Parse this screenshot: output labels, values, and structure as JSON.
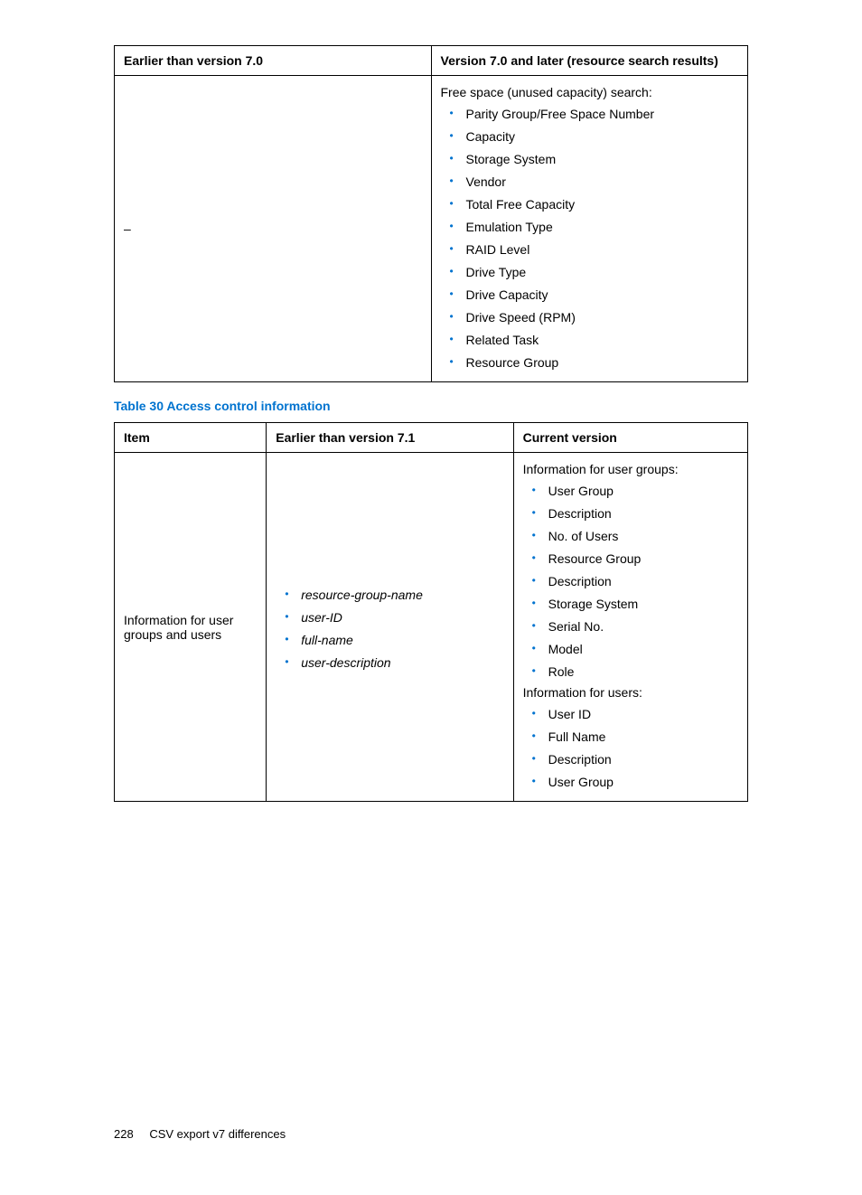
{
  "table1": {
    "headers": {
      "col1": "Earlier than version 7.0",
      "col2": "Version 7.0 and later (resource search results)"
    },
    "row": {
      "left": "–",
      "right": {
        "intro": "Free space (unused capacity) search:",
        "items": [
          "Parity Group/Free Space Number",
          "Capacity",
          "Storage System",
          "Vendor",
          "Total Free Capacity",
          "Emulation Type",
          "RAID Level",
          "Drive Type",
          "Drive Capacity",
          "Drive Speed (RPM)",
          "Related Task",
          "Resource Group"
        ]
      }
    }
  },
  "table2_caption": "Table 30 Access control information",
  "table2": {
    "headers": {
      "col1": "Item",
      "col2": "Earlier than version 7.1",
      "col3": "Current version"
    },
    "row": {
      "c1": "Information for user groups and users",
      "c2_items": [
        "resource-group-name",
        "user-ID",
        "full-name",
        "user-description"
      ],
      "c3": {
        "intro1": "Information for user groups:",
        "items1": [
          "User Group",
          "Description",
          "No. of Users",
          "Resource Group",
          "Description",
          "Storage System",
          "Serial No.",
          "Model",
          "Role"
        ],
        "intro2": "Information for users:",
        "items2": [
          "User ID",
          "Full Name",
          "Description",
          "User Group"
        ]
      }
    }
  },
  "footer": {
    "page_number": "228",
    "section": "CSV export v7 differences"
  }
}
